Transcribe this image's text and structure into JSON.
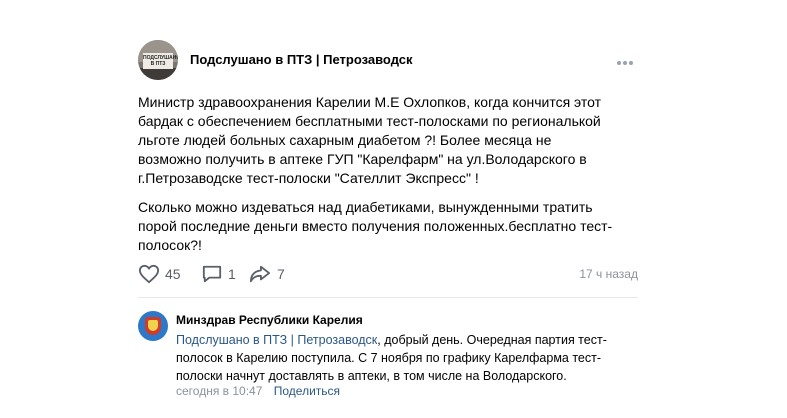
{
  "post": {
    "avatar_text": "ПОДСЛУШАНО В ПТЗ",
    "community": "Подслушано в ПТЗ | Петрозаводск",
    "paragraph1": "Министр здравоохранения Карелии М.Е Охлопков, когда кончится этот бардак с обеспечением бесплатными тест-полосками по региональкой льготе людей больных сахарным диабетом ?! Более месяца не возможно получить в аптеке ГУП \"Карелфарм\" на ул.Володарского в г.Петрозаводске тест-полоски \"Сателлит Экспресс\" !",
    "paragraph2": "Сколько можно издеваться над диабетиками, вынужденными тратить порой последние деньги вместо получения положенных.бесплатно тест-полосок?!",
    "likes": "45",
    "comments": "1",
    "shares": "7",
    "time": "17 ч назад"
  },
  "comment": {
    "author": "Минздрав Республики Карелия",
    "mention": "Подслушано в ПТЗ | Петрозаводск",
    "text": ", добрый день. Очередная партия тест-полосок в Карелию поступила. С 7 ноября по графику Карелфарма тест-полоски начнут доставлять в аптеки, в том числе на Володарского.",
    "time": "сегодня в 10:47",
    "reply_label": "Поделиться"
  },
  "icons": {
    "like": "heart-icon",
    "comment": "comment-icon",
    "share": "share-icon",
    "more": "more-icon"
  },
  "colors": {
    "link": "#2a5885",
    "muted": "#8b9299",
    "icon": "#5a6068"
  }
}
